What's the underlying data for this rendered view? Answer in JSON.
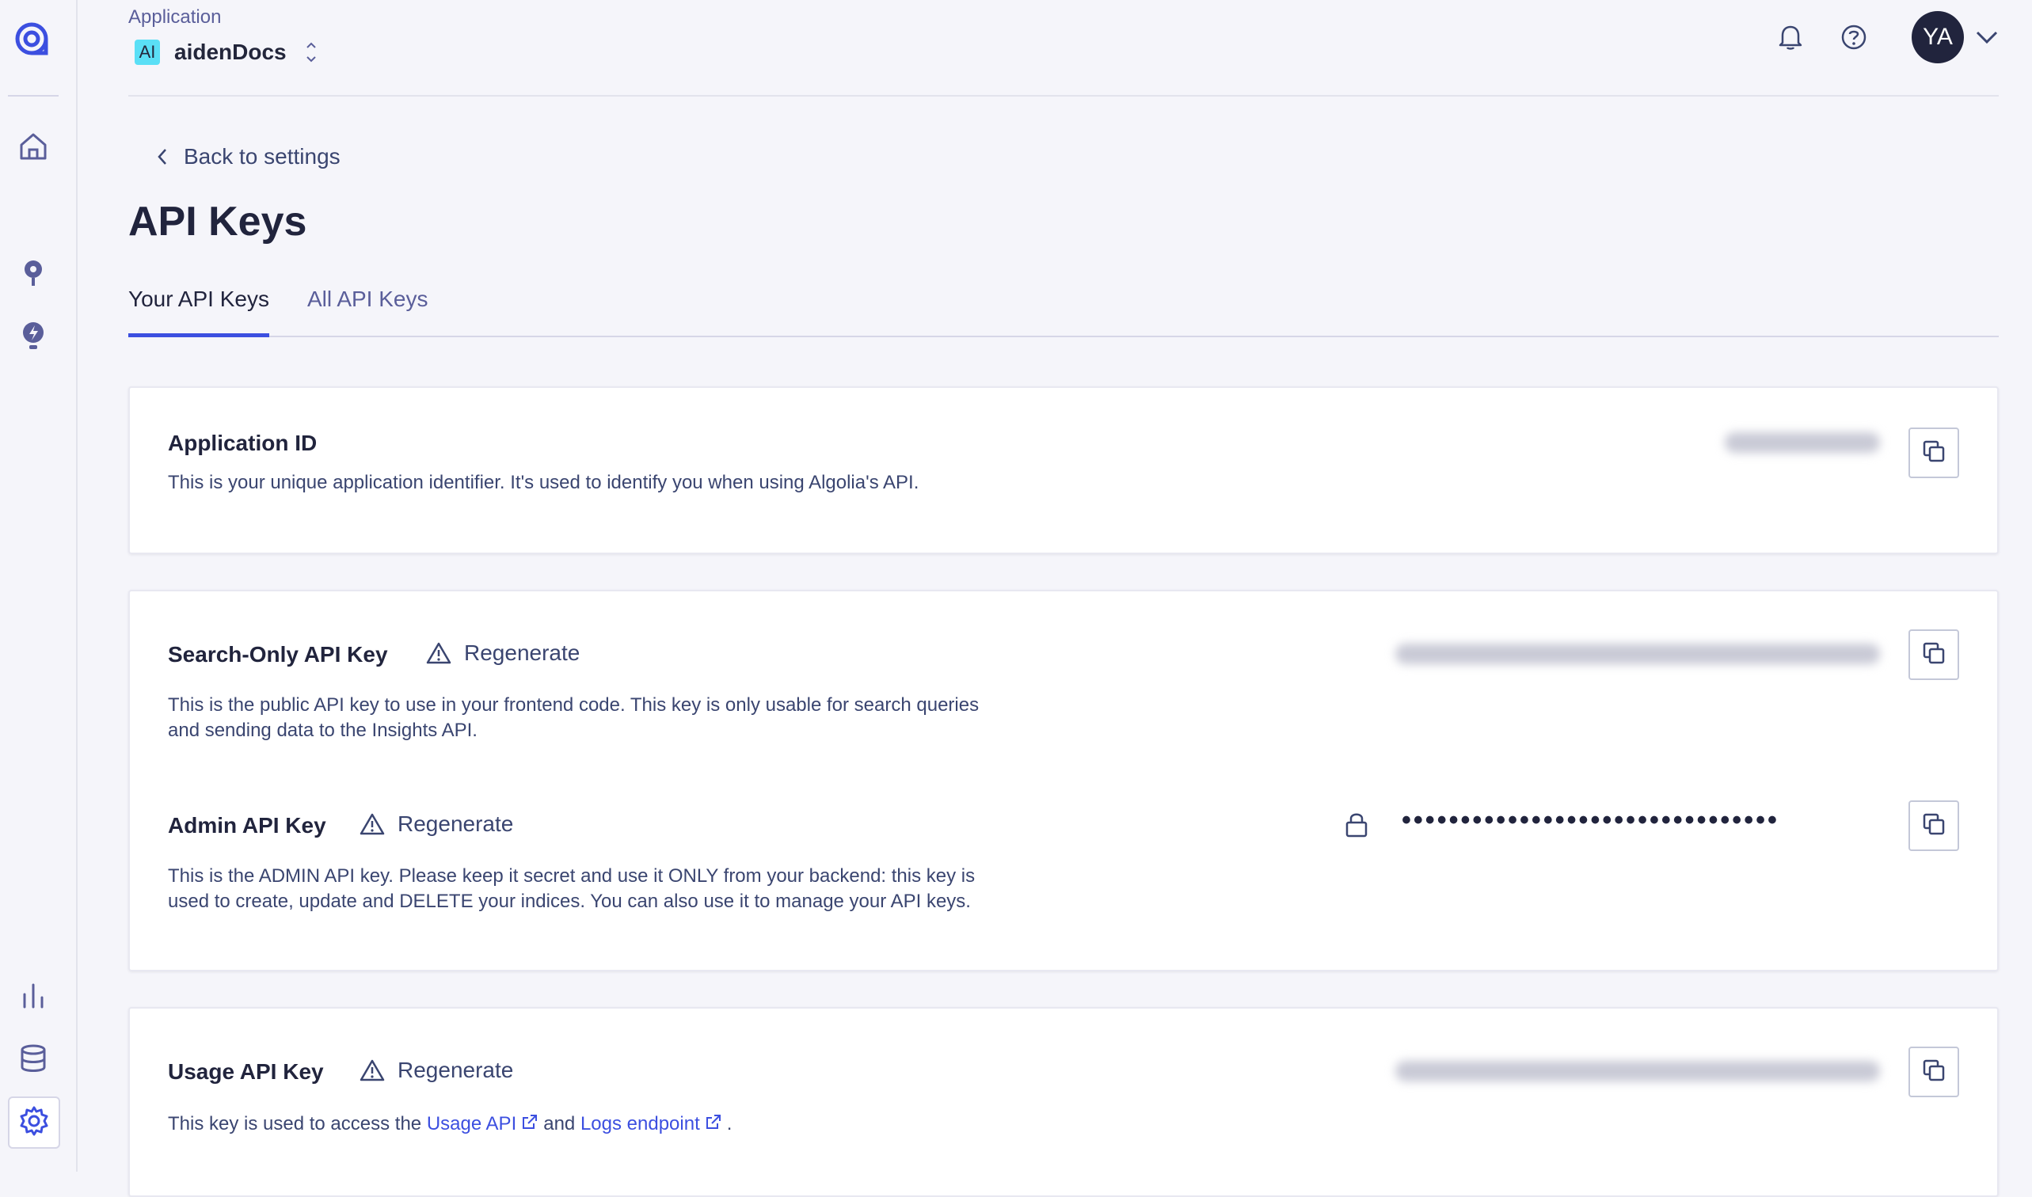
{
  "header": {
    "app_label": "Application",
    "app_badge": "AI",
    "app_name": "aidenDocs",
    "avatar_initials": "YA"
  },
  "sidebar": {
    "items": [
      {
        "icon": "algolia-logo-icon"
      },
      {
        "icon": "home-icon"
      },
      {
        "icon": "search-icon"
      },
      {
        "icon": "lightbulb-icon"
      },
      {
        "icon": "bar-chart-icon"
      },
      {
        "icon": "database-icon"
      },
      {
        "icon": "gear-icon",
        "active": true
      }
    ]
  },
  "page": {
    "back_label": "Back to settings",
    "title": "API Keys",
    "tabs": [
      {
        "label": "Your API Keys",
        "active": true
      },
      {
        "label": "All API Keys",
        "active": false
      }
    ]
  },
  "cards": {
    "application_id": {
      "title": "Application ID",
      "description": "This is your unique application identifier. It's used to identify you when using Algolia's API."
    },
    "search_only": {
      "title": "Search-Only API Key",
      "regenerate": "Regenerate",
      "description_line1": "This is the public API key to use in your frontend code. This key is only usable for search queries",
      "description_line2": "and sending data to the Insights API."
    },
    "admin": {
      "title": "Admin API Key",
      "regenerate": "Regenerate",
      "masked_value": "••••••••••••••••••••••••••••••••",
      "description_line1": "This is the ADMIN API key. Please keep it secret and use it ONLY from your backend: this key is",
      "description_line2": "used to create, update and DELETE your indices. You can also use it to manage your API keys."
    },
    "usage": {
      "title": "Usage API Key",
      "regenerate": "Regenerate",
      "description_prefix": "This key is used to access the",
      "usage_link": "Usage API",
      "description_and": "and",
      "logs_link": "Logs endpoint",
      "description_suffix": "."
    }
  },
  "colors": {
    "accent": "#3c4fe0",
    "text_dark": "#21243d",
    "text_muted": "#5a5e9a",
    "background": "#f5f5fa",
    "badge": "#5adff6"
  }
}
